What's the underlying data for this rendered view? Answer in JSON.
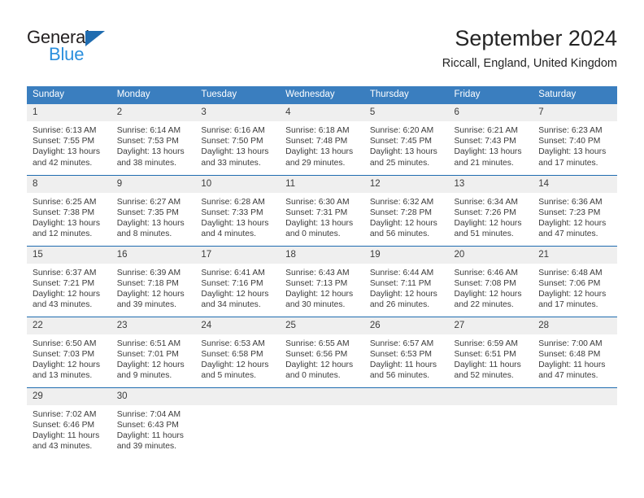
{
  "brand": {
    "name_part1": "General",
    "name_part2": "Blue",
    "logo_icon": "triangle-icon",
    "colors": {
      "dark": "#231f20",
      "blue": "#2b8fdd",
      "triangle": "#1f6cb0"
    }
  },
  "header": {
    "title": "September 2024",
    "subtitle": "Riccall, England, United Kingdom"
  },
  "theme": {
    "header_blue": "#3a7ebf",
    "separator_blue": "#1f6cb0",
    "daynum_band": "#efefef",
    "text": "#3b3b3b"
  },
  "calendar": {
    "weekday_headers": [
      "Sunday",
      "Monday",
      "Tuesday",
      "Wednesday",
      "Thursday",
      "Friday",
      "Saturday"
    ],
    "weeks": [
      [
        {
          "day": "1",
          "sunrise": "Sunrise: 6:13 AM",
          "sunset": "Sunset: 7:55 PM",
          "daylight1": "Daylight: 13 hours",
          "daylight2": "and 42 minutes."
        },
        {
          "day": "2",
          "sunrise": "Sunrise: 6:14 AM",
          "sunset": "Sunset: 7:53 PM",
          "daylight1": "Daylight: 13 hours",
          "daylight2": "and 38 minutes."
        },
        {
          "day": "3",
          "sunrise": "Sunrise: 6:16 AM",
          "sunset": "Sunset: 7:50 PM",
          "daylight1": "Daylight: 13 hours",
          "daylight2": "and 33 minutes."
        },
        {
          "day": "4",
          "sunrise": "Sunrise: 6:18 AM",
          "sunset": "Sunset: 7:48 PM",
          "daylight1": "Daylight: 13 hours",
          "daylight2": "and 29 minutes."
        },
        {
          "day": "5",
          "sunrise": "Sunrise: 6:20 AM",
          "sunset": "Sunset: 7:45 PM",
          "daylight1": "Daylight: 13 hours",
          "daylight2": "and 25 minutes."
        },
        {
          "day": "6",
          "sunrise": "Sunrise: 6:21 AM",
          "sunset": "Sunset: 7:43 PM",
          "daylight1": "Daylight: 13 hours",
          "daylight2": "and 21 minutes."
        },
        {
          "day": "7",
          "sunrise": "Sunrise: 6:23 AM",
          "sunset": "Sunset: 7:40 PM",
          "daylight1": "Daylight: 13 hours",
          "daylight2": "and 17 minutes."
        }
      ],
      [
        {
          "day": "8",
          "sunrise": "Sunrise: 6:25 AM",
          "sunset": "Sunset: 7:38 PM",
          "daylight1": "Daylight: 13 hours",
          "daylight2": "and 12 minutes."
        },
        {
          "day": "9",
          "sunrise": "Sunrise: 6:27 AM",
          "sunset": "Sunset: 7:35 PM",
          "daylight1": "Daylight: 13 hours",
          "daylight2": "and 8 minutes."
        },
        {
          "day": "10",
          "sunrise": "Sunrise: 6:28 AM",
          "sunset": "Sunset: 7:33 PM",
          "daylight1": "Daylight: 13 hours",
          "daylight2": "and 4 minutes."
        },
        {
          "day": "11",
          "sunrise": "Sunrise: 6:30 AM",
          "sunset": "Sunset: 7:31 PM",
          "daylight1": "Daylight: 13 hours",
          "daylight2": "and 0 minutes."
        },
        {
          "day": "12",
          "sunrise": "Sunrise: 6:32 AM",
          "sunset": "Sunset: 7:28 PM",
          "daylight1": "Daylight: 12 hours",
          "daylight2": "and 56 minutes."
        },
        {
          "day": "13",
          "sunrise": "Sunrise: 6:34 AM",
          "sunset": "Sunset: 7:26 PM",
          "daylight1": "Daylight: 12 hours",
          "daylight2": "and 51 minutes."
        },
        {
          "day": "14",
          "sunrise": "Sunrise: 6:36 AM",
          "sunset": "Sunset: 7:23 PM",
          "daylight1": "Daylight: 12 hours",
          "daylight2": "and 47 minutes."
        }
      ],
      [
        {
          "day": "15",
          "sunrise": "Sunrise: 6:37 AM",
          "sunset": "Sunset: 7:21 PM",
          "daylight1": "Daylight: 12 hours",
          "daylight2": "and 43 minutes."
        },
        {
          "day": "16",
          "sunrise": "Sunrise: 6:39 AM",
          "sunset": "Sunset: 7:18 PM",
          "daylight1": "Daylight: 12 hours",
          "daylight2": "and 39 minutes."
        },
        {
          "day": "17",
          "sunrise": "Sunrise: 6:41 AM",
          "sunset": "Sunset: 7:16 PM",
          "daylight1": "Daylight: 12 hours",
          "daylight2": "and 34 minutes."
        },
        {
          "day": "18",
          "sunrise": "Sunrise: 6:43 AM",
          "sunset": "Sunset: 7:13 PM",
          "daylight1": "Daylight: 12 hours",
          "daylight2": "and 30 minutes."
        },
        {
          "day": "19",
          "sunrise": "Sunrise: 6:44 AM",
          "sunset": "Sunset: 7:11 PM",
          "daylight1": "Daylight: 12 hours",
          "daylight2": "and 26 minutes."
        },
        {
          "day": "20",
          "sunrise": "Sunrise: 6:46 AM",
          "sunset": "Sunset: 7:08 PM",
          "daylight1": "Daylight: 12 hours",
          "daylight2": "and 22 minutes."
        },
        {
          "day": "21",
          "sunrise": "Sunrise: 6:48 AM",
          "sunset": "Sunset: 7:06 PM",
          "daylight1": "Daylight: 12 hours",
          "daylight2": "and 17 minutes."
        }
      ],
      [
        {
          "day": "22",
          "sunrise": "Sunrise: 6:50 AM",
          "sunset": "Sunset: 7:03 PM",
          "daylight1": "Daylight: 12 hours",
          "daylight2": "and 13 minutes."
        },
        {
          "day": "23",
          "sunrise": "Sunrise: 6:51 AM",
          "sunset": "Sunset: 7:01 PM",
          "daylight1": "Daylight: 12 hours",
          "daylight2": "and 9 minutes."
        },
        {
          "day": "24",
          "sunrise": "Sunrise: 6:53 AM",
          "sunset": "Sunset: 6:58 PM",
          "daylight1": "Daylight: 12 hours",
          "daylight2": "and 5 minutes."
        },
        {
          "day": "25",
          "sunrise": "Sunrise: 6:55 AM",
          "sunset": "Sunset: 6:56 PM",
          "daylight1": "Daylight: 12 hours",
          "daylight2": "and 0 minutes."
        },
        {
          "day": "26",
          "sunrise": "Sunrise: 6:57 AM",
          "sunset": "Sunset: 6:53 PM",
          "daylight1": "Daylight: 11 hours",
          "daylight2": "and 56 minutes."
        },
        {
          "day": "27",
          "sunrise": "Sunrise: 6:59 AM",
          "sunset": "Sunset: 6:51 PM",
          "daylight1": "Daylight: 11 hours",
          "daylight2": "and 52 minutes."
        },
        {
          "day": "28",
          "sunrise": "Sunrise: 7:00 AM",
          "sunset": "Sunset: 6:48 PM",
          "daylight1": "Daylight: 11 hours",
          "daylight2": "and 47 minutes."
        }
      ],
      [
        {
          "day": "29",
          "sunrise": "Sunrise: 7:02 AM",
          "sunset": "Sunset: 6:46 PM",
          "daylight1": "Daylight: 11 hours",
          "daylight2": "and 43 minutes."
        },
        {
          "day": "30",
          "sunrise": "Sunrise: 7:04 AM",
          "sunset": "Sunset: 6:43 PM",
          "daylight1": "Daylight: 11 hours",
          "daylight2": "and 39 minutes."
        },
        {
          "day": "",
          "sunrise": "",
          "sunset": "",
          "daylight1": "",
          "daylight2": ""
        },
        {
          "day": "",
          "sunrise": "",
          "sunset": "",
          "daylight1": "",
          "daylight2": ""
        },
        {
          "day": "",
          "sunrise": "",
          "sunset": "",
          "daylight1": "",
          "daylight2": ""
        },
        {
          "day": "",
          "sunrise": "",
          "sunset": "",
          "daylight1": "",
          "daylight2": ""
        },
        {
          "day": "",
          "sunrise": "",
          "sunset": "",
          "daylight1": "",
          "daylight2": ""
        }
      ]
    ]
  }
}
